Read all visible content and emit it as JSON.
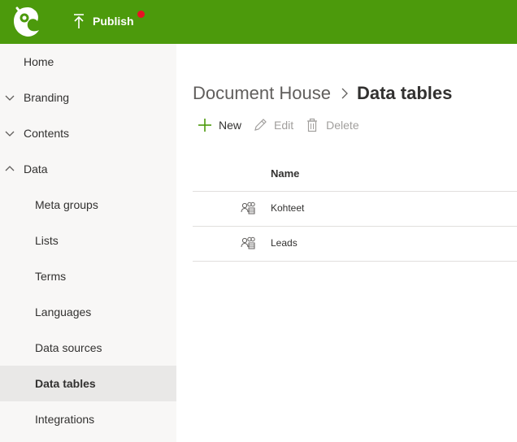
{
  "header": {
    "logo_icon": "chameleon-logo-icon",
    "publish_label": "Publish",
    "publish_icon": "upload-arrow-icon",
    "notification_color": "#e81123",
    "brand_color": "#4c9a0c"
  },
  "sidebar": {
    "items": [
      {
        "label": "Home",
        "chevron": "none"
      },
      {
        "label": "Branding",
        "chevron": "down"
      },
      {
        "label": "Contents",
        "chevron": "down"
      },
      {
        "label": "Data",
        "chevron": "up",
        "expanded": true
      },
      {
        "label": "Meta groups",
        "sub": true
      },
      {
        "label": "Lists",
        "sub": true
      },
      {
        "label": "Terms",
        "sub": true
      },
      {
        "label": "Languages",
        "sub": true
      },
      {
        "label": "Data sources",
        "sub": true
      },
      {
        "label": "Data tables",
        "sub": true,
        "active": true
      },
      {
        "label": "Integrations",
        "sub": true
      }
    ]
  },
  "breadcrumb": {
    "root": "Document House",
    "current": "Data tables"
  },
  "commands": {
    "new": "New",
    "edit": "Edit",
    "delete": "Delete"
  },
  "table": {
    "columns": [
      "Name"
    ],
    "rows": [
      {
        "name": "Kohteet",
        "icon": "people-group-icon"
      },
      {
        "name": "Leads",
        "icon": "people-group-icon"
      }
    ]
  }
}
